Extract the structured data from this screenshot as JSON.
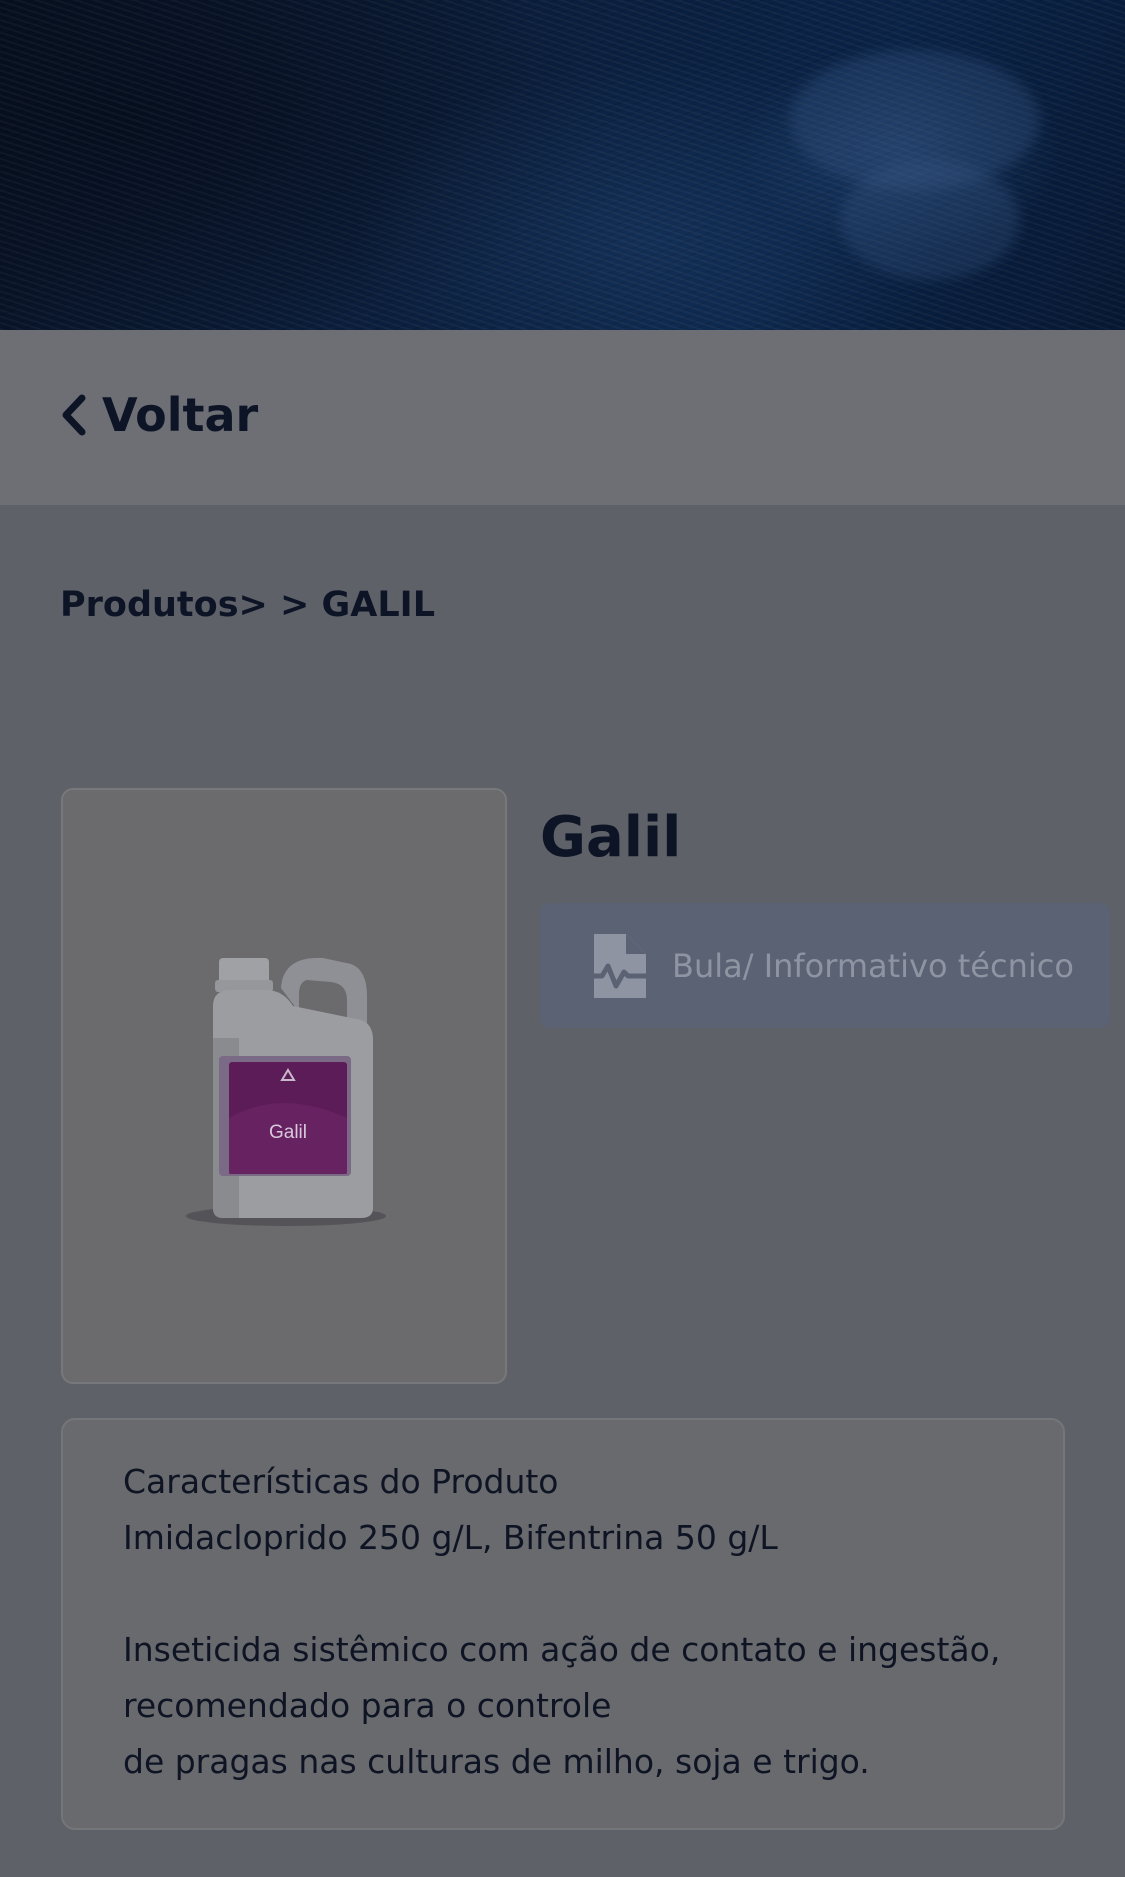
{
  "nav": {
    "back_label": "Voltar"
  },
  "breadcrumb": "Produtos> > GALIL",
  "product": {
    "name": "Galil",
    "package_label": "Galil",
    "doc_button_label": "Bula/ Informativo técnico"
  },
  "characteristics": {
    "heading": "Características do Produto",
    "composition": "Imidacloprido 250 g/L, Bifentrina 50 g/L",
    "description_lines": [
      "Inseticida sistêmico com ação de contato e ingestão,",
      "recomendado para o controle",
      "de pragas nas culturas de milho, soja e trigo."
    ]
  },
  "colors": {
    "overlay_bg": "#5f6168",
    "text_dark": "#0c1426",
    "button_bg": "#5a6274",
    "label_purple": "#5b1c57"
  }
}
